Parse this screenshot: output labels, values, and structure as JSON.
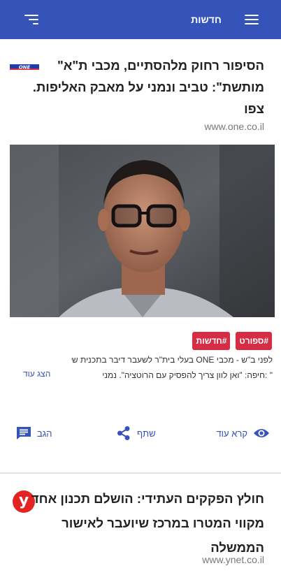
{
  "header": {
    "title": "חדשות",
    "bg_color": "#3553b8",
    "menu_icon": "hamburger-menu-icon",
    "filter_icon": "sort-filter-icon"
  },
  "articles": [
    {
      "headline_lines": [
        "הסיפור רחוק מלהסתיים, מכבי ת\"א\"",
        "מותשת\": טביב ונמני על מאבק האליפות.",
        "צפו"
      ],
      "source_url": "www.one.co.il",
      "source_logo": "ONE",
      "tags": [
        "#ספורט",
        "#חדשות"
      ],
      "tag_color": "#d72c44",
      "summary_lines": [
        "לפני ב\"ש - מכבי ONE בעלי בית\"ר לשעבר דיבר בתכנית של",
        "\" :חיפה: \"ואן לוון צריך להפסיק עם הרוטציה\". נמני"
      ],
      "show_more": "הצג עוד",
      "actions": {
        "read_more": "קרא עוד",
        "share": "שתף",
        "comment": "הגב"
      }
    },
    {
      "headline_lines": [
        "חולץ הפקקים העתידי: הושלם תכנון אחד",
        "מקווי המטרו במרכז שיועבר לאישור",
        "הממשלה"
      ],
      "source_url": "www.ynet.co.il",
      "source_logo": "y"
    }
  ]
}
